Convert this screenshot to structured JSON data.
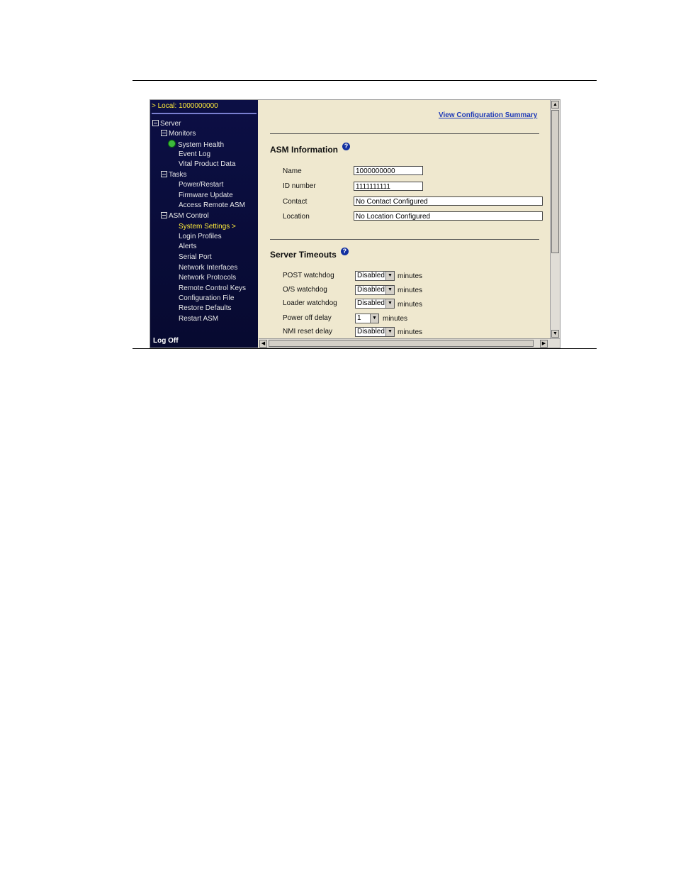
{
  "sidebar": {
    "header": "> Local:  1000000000",
    "tree": {
      "server": "Server",
      "monitors": "Monitors",
      "system_health": "System Health",
      "event_log": "Event Log",
      "vital_product_data": "Vital Product Data",
      "tasks": "Tasks",
      "power_restart": "Power/Restart",
      "firmware_update": "Firmware Update",
      "access_remote_asm": "Access Remote ASM",
      "asm_control": "ASM Control",
      "system_settings": "System Settings >",
      "login_profiles": "Login Profiles",
      "alerts": "Alerts",
      "serial_port": "Serial Port",
      "network_interfaces": "Network Interfaces",
      "network_protocols": "Network Protocols",
      "remote_control_keys": "Remote Control Keys",
      "configuration_file": "Configuration File",
      "restore_defaults": "Restore Defaults",
      "restart_asm": "Restart ASM"
    },
    "log_off": "Log Off"
  },
  "main": {
    "view_summary_link": "View Configuration Summary",
    "asm_info": {
      "title": "ASM Information",
      "name_label": "Name",
      "name_value": "1000000000",
      "id_label": "ID number",
      "id_value": "1111111111",
      "contact_label": "Contact",
      "contact_value": "No Contact Configured",
      "location_label": "Location",
      "location_value": "No Location Configured"
    },
    "timeouts": {
      "title": "Server Timeouts",
      "post_label": "POST watchdog",
      "post_value": "Disabled",
      "os_label": "O/S watchdog",
      "os_value": "Disabled",
      "loader_label": "Loader watchdog",
      "loader_value": "Disabled",
      "power_off_label": "Power off delay",
      "power_off_value": "1",
      "nmi_label": "NMI reset delay",
      "nmi_value": "Disabled",
      "unit": "minutes"
    }
  },
  "icons": {
    "help": "?",
    "down_arrow": "▼",
    "up_arrow": "▲",
    "left_arrow": "◀",
    "right_arrow": "▶"
  }
}
